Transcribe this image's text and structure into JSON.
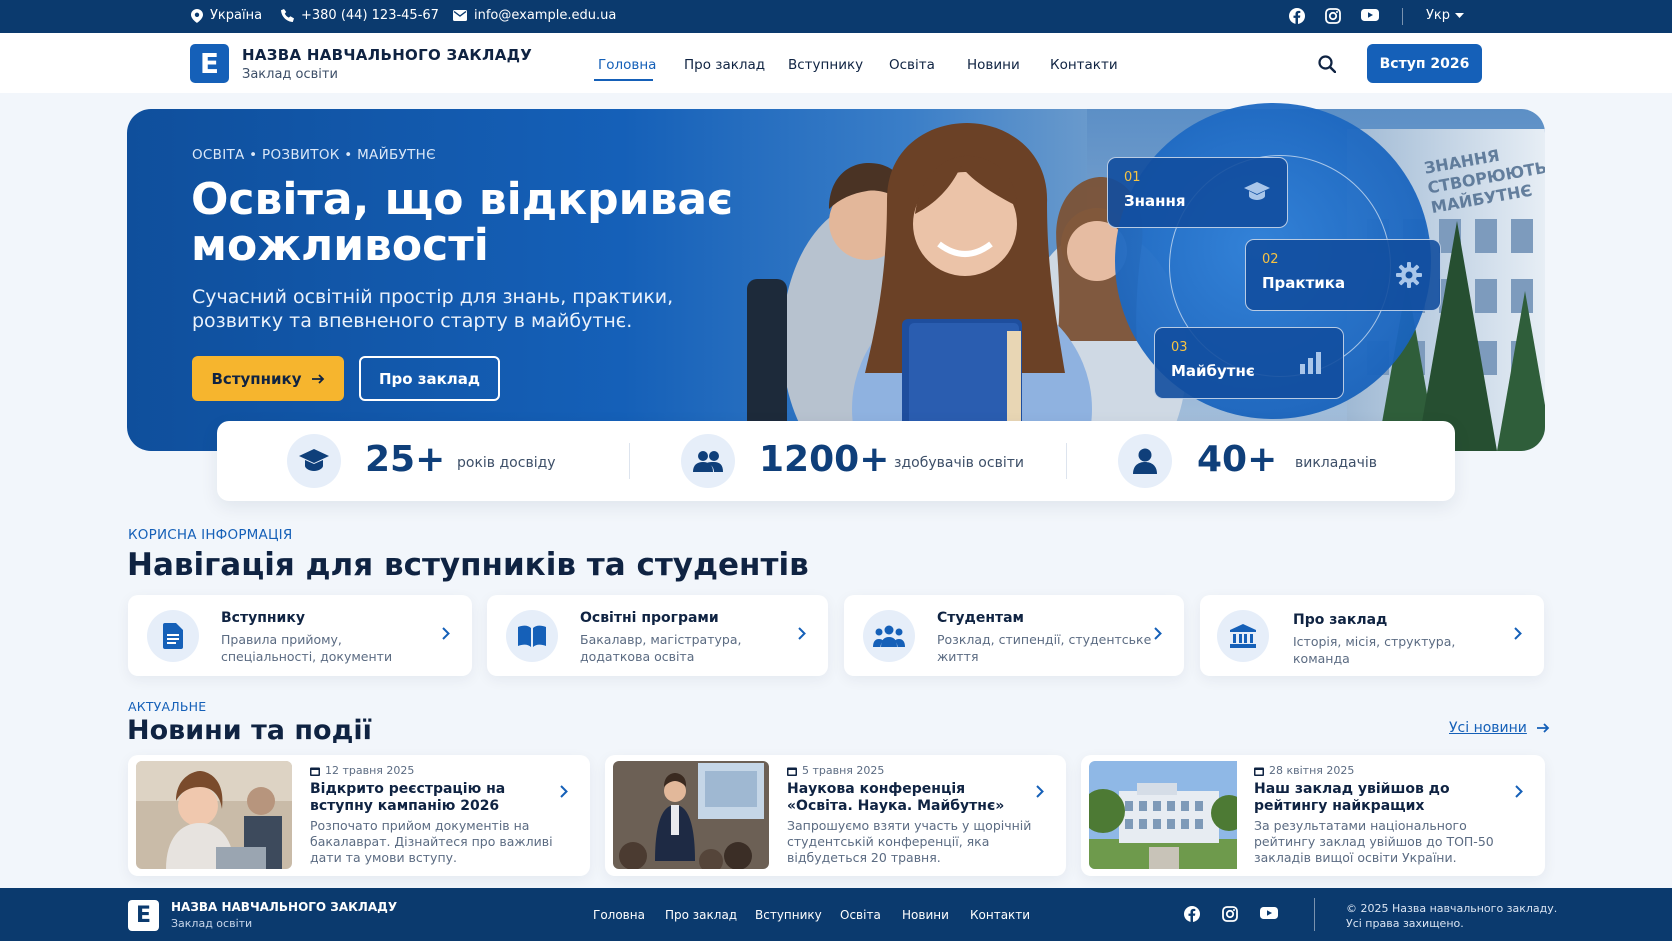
{
  "topbar": {
    "location": "Україна",
    "phone": "+380 (44) 123-45-67",
    "email": "info@example.edu.ua",
    "language": "Укр"
  },
  "header": {
    "logo_letter": "E",
    "title": "НАЗВА НАВЧАЛЬНОГО ЗАКЛАДУ",
    "subtitle": "Заклад освіти",
    "nav": [
      "Головна",
      "Про заклад",
      "Вступнику",
      "Освіта",
      "Новини",
      "Контакти"
    ],
    "active_nav": "Головна",
    "cta": "Вступ 2026"
  },
  "hero": {
    "kicker": "ОСВІТА • РОЗВИТОК • МАЙБУТНЄ",
    "title": "Освіта, що відкриває можливості",
    "subtitle": "Сучасний освітній простір для знань, практики, розвитку та впевненого старту в майбутнє.",
    "primary_button": "Вступнику",
    "secondary_button": "Про заклад",
    "steps": [
      {
        "num": "01",
        "label": "Знання",
        "icon": "graduation-cap-icon"
      },
      {
        "num": "02",
        "label": "Практика",
        "icon": "gear-icon"
      },
      {
        "num": "03",
        "label": "Майбутнє",
        "icon": "bar-chart-icon"
      }
    ],
    "wall_text": "ЗНАННЯ СТВОРЮЮТЬ МАЙБУТНЄ"
  },
  "stats": [
    {
      "value": "25+",
      "label": "років досвіду",
      "icon": "graduation-cap-icon"
    },
    {
      "value": "1200+",
      "label": "здобувачів освіти",
      "icon": "users-icon"
    },
    {
      "value": "40+",
      "label": "викладачів",
      "icon": "user-icon"
    }
  ],
  "nav_section": {
    "kicker": "КОРИСНА ІНФОРМАЦІЯ",
    "title": "Навігація для вступників та студентів",
    "cards": [
      {
        "title": "Вступнику",
        "desc": "Правила прийому, спеціальності, документи",
        "icon": "document-icon"
      },
      {
        "title": "Освітні програми",
        "desc": "Бакалавр, магістратура, додаткова освіта",
        "icon": "book-icon"
      },
      {
        "title": "Студентам",
        "desc": "Розклад, стипендії, студентське життя",
        "icon": "users-icon"
      },
      {
        "title": "Про заклад",
        "desc": "Історія, місія, структура, команда",
        "icon": "building-icon"
      }
    ]
  },
  "news_section": {
    "kicker": "АКТУАЛЬНЕ",
    "title": "Новини та події",
    "all_link": "Усі новини",
    "items": [
      {
        "date": "12 травня 2025",
        "title": "Відкрито реєстрацію на вступну кампанію 2026",
        "desc": "Розпочато прийом документів на бакалаврат. Дізнайтеся про важливі дати та умови вступу."
      },
      {
        "date": "5 травня 2025",
        "title": "Наукова конференція «Освіта. Наука. Майбутнє»",
        "desc": "Запрошуємо взяти участь у щорічній студентській конференції, яка відбудеться 20 травня."
      },
      {
        "date": "28 квітня 2025",
        "title": "Наш заклад увійшов до рейтингу найкращих",
        "desc": "За результатами національного рейтингу заклад увійшов до ТОП-50 закладів вищої освіти України."
      }
    ]
  },
  "footer": {
    "title": "НАЗВА НАВЧАЛЬНОГО ЗАКЛАДУ",
    "subtitle": "Заклад освіти",
    "nav": [
      "Головна",
      "Про заклад",
      "Вступнику",
      "Освіта",
      "Новини",
      "Контакти"
    ],
    "copyright_1": "© 2025 Назва навчального закладу.",
    "copyright_2": "Усі права захищено."
  },
  "colors": {
    "primary": "#1560b8",
    "dark": "#0b3a6e",
    "accent": "#f6b52e",
    "step_number": "#f6c343"
  }
}
